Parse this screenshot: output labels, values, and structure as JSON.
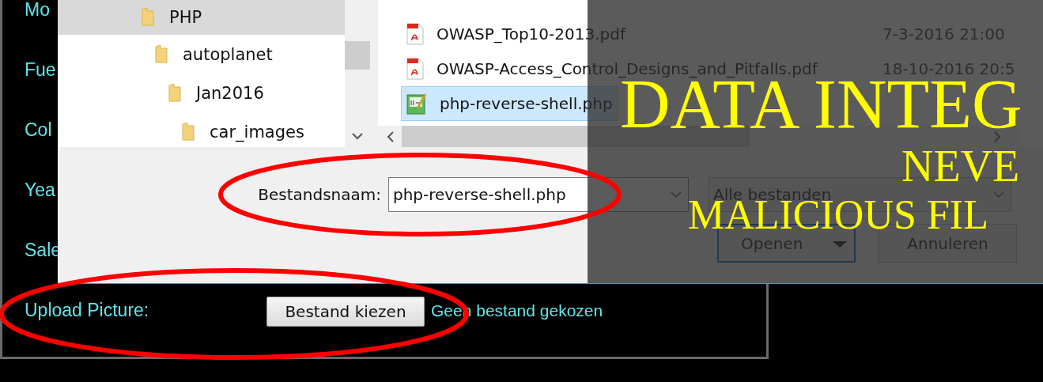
{
  "page": {
    "form_labels": [
      "Mo",
      "Fue",
      "Col",
      "Yea",
      "Sale"
    ],
    "upload": {
      "label": "Upload Picture:",
      "button": "Bestand kiezen",
      "status": "Geen bestand gekozen"
    }
  },
  "dialog": {
    "folders": [
      {
        "name": "PHP",
        "selected": true,
        "children": [
          {
            "name": "autoplanet",
            "selected": false,
            "children": [
              {
                "name": "Jan2016",
                "selected": false,
                "children": [
                  {
                    "name": "car_images",
                    "selected": false
                  }
                ]
              }
            ]
          }
        ]
      }
    ],
    "files": [
      {
        "name": "OWASP_Top10-2013.pdf",
        "kind": "pdf",
        "modified": "7-3-2016 21:00",
        "selected": false
      },
      {
        "name": "OWASP-Access_Control_Designs_and_Pitfalls.pdf",
        "kind": "pdf",
        "modified": "18-10-2016 20:5",
        "selected": false
      },
      {
        "name": "php-reverse-shell.php",
        "kind": "script",
        "selected": true
      }
    ],
    "filename_label": "Bestandsnaam:",
    "filename_value": "php-reverse-shell.php",
    "filter": "Alle bestanden",
    "buttons": [
      "Openen",
      "Annuleren"
    ]
  },
  "slide_overlay": {
    "title": "DATA INTEG",
    "lines": [
      "NEVE",
      "MALICIOUS FIL"
    ]
  }
}
